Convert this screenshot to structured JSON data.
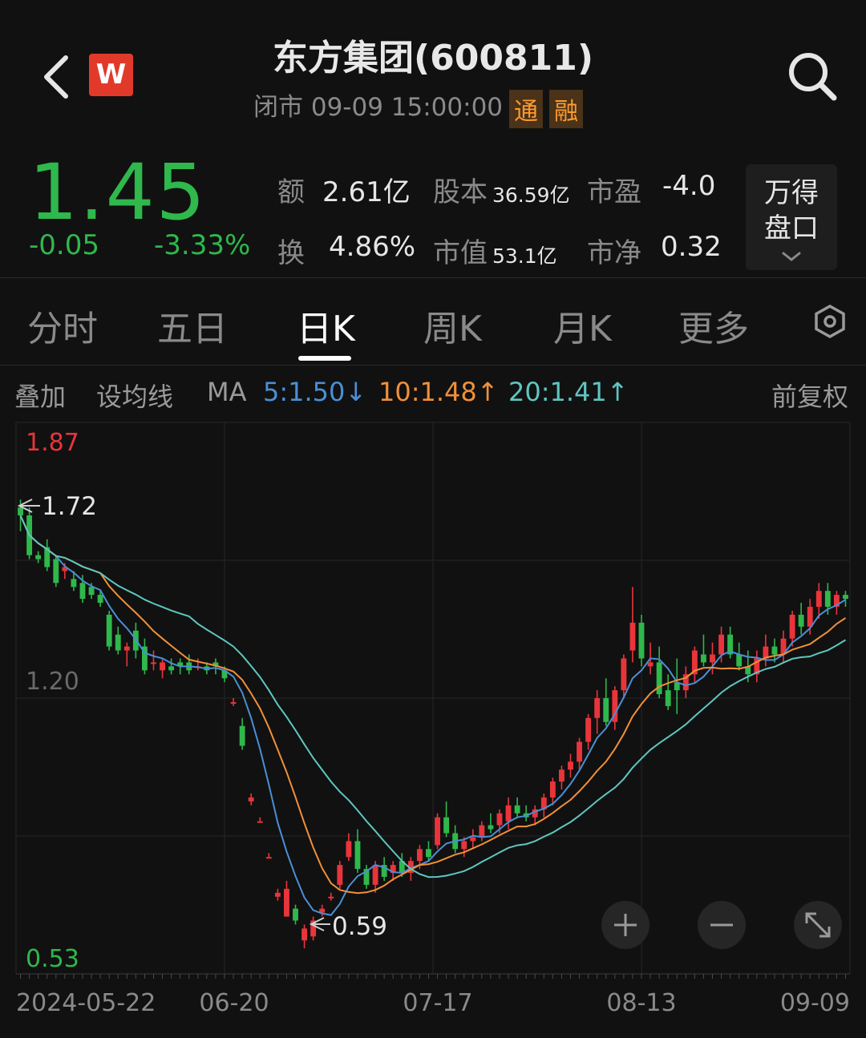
{
  "header": {
    "title": "东方集团(600811)",
    "status": "闭市 09-09 15:00:00",
    "tag1": "通",
    "tag2": "融",
    "logo": "W"
  },
  "quote": {
    "price": "1.45",
    "change": "-0.05",
    "change_pct": "-3.33%",
    "amount_label": "额",
    "amount": "2.61亿",
    "capital_label": "股本",
    "capital": "36.59亿",
    "pe_label": "市盈",
    "pe": "-4.0",
    "turnover_label": "换",
    "turnover": "4.86%",
    "mktcap_label": "市值",
    "mktcap": "53.1亿",
    "pb_label": "市净",
    "pb": "0.32",
    "panel_button_line1": "万得",
    "panel_button_line2": "盘口"
  },
  "tabs": [
    "分时",
    "五日",
    "日K",
    "周K",
    "月K",
    "更多"
  ],
  "active_tab": "日K",
  "ma_row": {
    "overlay": "叠加",
    "set_ma": "设均线",
    "ma": "MA",
    "ma5": "5:1.50↓",
    "ma10": "10:1.48↑",
    "ma20": "20:1.41↑",
    "adjust": "前复权"
  },
  "colors": {
    "up": "#e8353b",
    "down": "#2fb84c",
    "ma5": "#4a8fd6",
    "ma10": "#f0903a",
    "ma20": "#5fc6c0"
  },
  "icons": [
    "back-icon",
    "search-icon",
    "settings-icon",
    "zoom-in-icon",
    "zoom-out-icon",
    "expand-icon"
  ],
  "chart_data": {
    "type": "candlestick",
    "y_max_label": "1.87",
    "y_mid_label": "1.20",
    "y_min_label": "0.53",
    "ylim": [
      0.53,
      1.87
    ],
    "high_marker": "1.72",
    "low_marker": "0.59",
    "x_labels": [
      "2024-05-22",
      "06-20",
      "07-17",
      "08-13",
      "09-09"
    ],
    "ohlc": [
      [
        1.68,
        1.7,
        1.62,
        1.66
      ],
      [
        1.66,
        1.68,
        1.55,
        1.56
      ],
      [
        1.56,
        1.57,
        1.54,
        1.55
      ],
      [
        1.58,
        1.6,
        1.52,
        1.53
      ],
      [
        1.55,
        1.56,
        1.48,
        1.49
      ],
      [
        1.52,
        1.54,
        1.5,
        1.53
      ],
      [
        1.5,
        1.52,
        1.47,
        1.48
      ],
      [
        1.49,
        1.51,
        1.44,
        1.45
      ],
      [
        1.48,
        1.49,
        1.45,
        1.46
      ],
      [
        1.46,
        1.47,
        1.43,
        1.44
      ],
      [
        1.41,
        1.42,
        1.32,
        1.33
      ],
      [
        1.36,
        1.38,
        1.31,
        1.32
      ],
      [
        1.32,
        1.34,
        1.28,
        1.33
      ],
      [
        1.37,
        1.39,
        1.3,
        1.32
      ],
      [
        1.33,
        1.35,
        1.26,
        1.27
      ],
      [
        1.29,
        1.32,
        1.27,
        1.29
      ],
      [
        1.27,
        1.3,
        1.25,
        1.29
      ],
      [
        1.28,
        1.3,
        1.26,
        1.27
      ],
      [
        1.29,
        1.3,
        1.26,
        1.28
      ],
      [
        1.29,
        1.31,
        1.26,
        1.27
      ],
      [
        1.28,
        1.3,
        1.27,
        1.28
      ],
      [
        1.28,
        1.29,
        1.26,
        1.27
      ],
      [
        1.29,
        1.3,
        1.26,
        1.28
      ],
      [
        1.27,
        1.28,
        1.24,
        1.25
      ],
      [
        1.19,
        1.2,
        1.18,
        1.19
      ],
      [
        1.13,
        1.15,
        1.07,
        1.08
      ],
      [
        0.94,
        0.96,
        0.93,
        0.95
      ],
      [
        0.89,
        0.9,
        0.89,
        0.89
      ],
      [
        0.8,
        0.81,
        0.8,
        0.8
      ],
      [
        0.7,
        0.72,
        0.69,
        0.71
      ],
      [
        0.65,
        0.74,
        0.65,
        0.72
      ],
      [
        0.67,
        0.68,
        0.63,
        0.64
      ],
      [
        0.59,
        0.63,
        0.57,
        0.62
      ],
      [
        0.6,
        0.65,
        0.59,
        0.64
      ],
      [
        0.66,
        0.68,
        0.65,
        0.67
      ],
      [
        0.7,
        0.71,
        0.69,
        0.7
      ],
      [
        0.73,
        0.79,
        0.72,
        0.78
      ],
      [
        0.8,
        0.86,
        0.79,
        0.84
      ],
      [
        0.84,
        0.87,
        0.76,
        0.77
      ],
      [
        0.77,
        0.78,
        0.72,
        0.73
      ],
      [
        0.73,
        0.79,
        0.71,
        0.78
      ],
      [
        0.78,
        0.8,
        0.74,
        0.75
      ],
      [
        0.76,
        0.79,
        0.74,
        0.78
      ],
      [
        0.79,
        0.81,
        0.75,
        0.76
      ],
      [
        0.76,
        0.8,
        0.74,
        0.79
      ],
      [
        0.79,
        0.83,
        0.77,
        0.82
      ],
      [
        0.82,
        0.84,
        0.79,
        0.8
      ],
      [
        0.83,
        0.91,
        0.82,
        0.9
      ],
      [
        0.9,
        0.94,
        0.85,
        0.86
      ],
      [
        0.86,
        0.88,
        0.81,
        0.82
      ],
      [
        0.82,
        0.85,
        0.8,
        0.84
      ],
      [
        0.84,
        0.87,
        0.82,
        0.85
      ],
      [
        0.85,
        0.89,
        0.84,
        0.88
      ],
      [
        0.88,
        0.91,
        0.86,
        0.87
      ],
      [
        0.88,
        0.92,
        0.86,
        0.91
      ],
      [
        0.89,
        0.95,
        0.87,
        0.93
      ],
      [
        0.93,
        0.95,
        0.9,
        0.91
      ],
      [
        0.91,
        0.93,
        0.89,
        0.9
      ],
      [
        0.9,
        0.93,
        0.88,
        0.92
      ],
      [
        0.92,
        0.96,
        0.9,
        0.95
      ],
      [
        0.95,
        1.0,
        0.93,
        0.99
      ],
      [
        0.99,
        1.03,
        0.97,
        1.02
      ],
      [
        1.02,
        1.06,
        1.0,
        1.04
      ],
      [
        1.04,
        1.1,
        1.02,
        1.09
      ],
      [
        1.09,
        1.16,
        1.07,
        1.15
      ],
      [
        1.15,
        1.22,
        1.11,
        1.2
      ],
      [
        1.2,
        1.25,
        1.13,
        1.14
      ],
      [
        1.14,
        1.23,
        1.12,
        1.22
      ],
      [
        1.22,
        1.31,
        1.2,
        1.3
      ],
      [
        1.32,
        1.48,
        1.29,
        1.39
      ],
      [
        1.39,
        1.41,
        1.28,
        1.3
      ],
      [
        1.28,
        1.34,
        1.26,
        1.29
      ],
      [
        1.29,
        1.33,
        1.2,
        1.21
      ],
      [
        1.22,
        1.26,
        1.17,
        1.18
      ],
      [
        1.24,
        1.3,
        1.16,
        1.22
      ],
      [
        1.22,
        1.28,
        1.2,
        1.26
      ],
      [
        1.26,
        1.33,
        1.24,
        1.32
      ],
      [
        1.31,
        1.36,
        1.28,
        1.29
      ],
      [
        1.29,
        1.34,
        1.26,
        1.31
      ],
      [
        1.31,
        1.38,
        1.29,
        1.36
      ],
      [
        1.36,
        1.38,
        1.3,
        1.31
      ],
      [
        1.31,
        1.34,
        1.27,
        1.28
      ],
      [
        1.28,
        1.32,
        1.24,
        1.26
      ],
      [
        1.26,
        1.32,
        1.24,
        1.3
      ],
      [
        1.3,
        1.36,
        1.28,
        1.33
      ],
      [
        1.33,
        1.35,
        1.29,
        1.31
      ],
      [
        1.31,
        1.37,
        1.29,
        1.35
      ],
      [
        1.35,
        1.42,
        1.33,
        1.41
      ],
      [
        1.41,
        1.44,
        1.36,
        1.38
      ],
      [
        1.38,
        1.45,
        1.36,
        1.43
      ],
      [
        1.43,
        1.49,
        1.4,
        1.47
      ],
      [
        1.47,
        1.49,
        1.41,
        1.43
      ],
      [
        1.43,
        1.47,
        1.41,
        1.46
      ],
      [
        1.46,
        1.47,
        1.43,
        1.45
      ]
    ]
  }
}
